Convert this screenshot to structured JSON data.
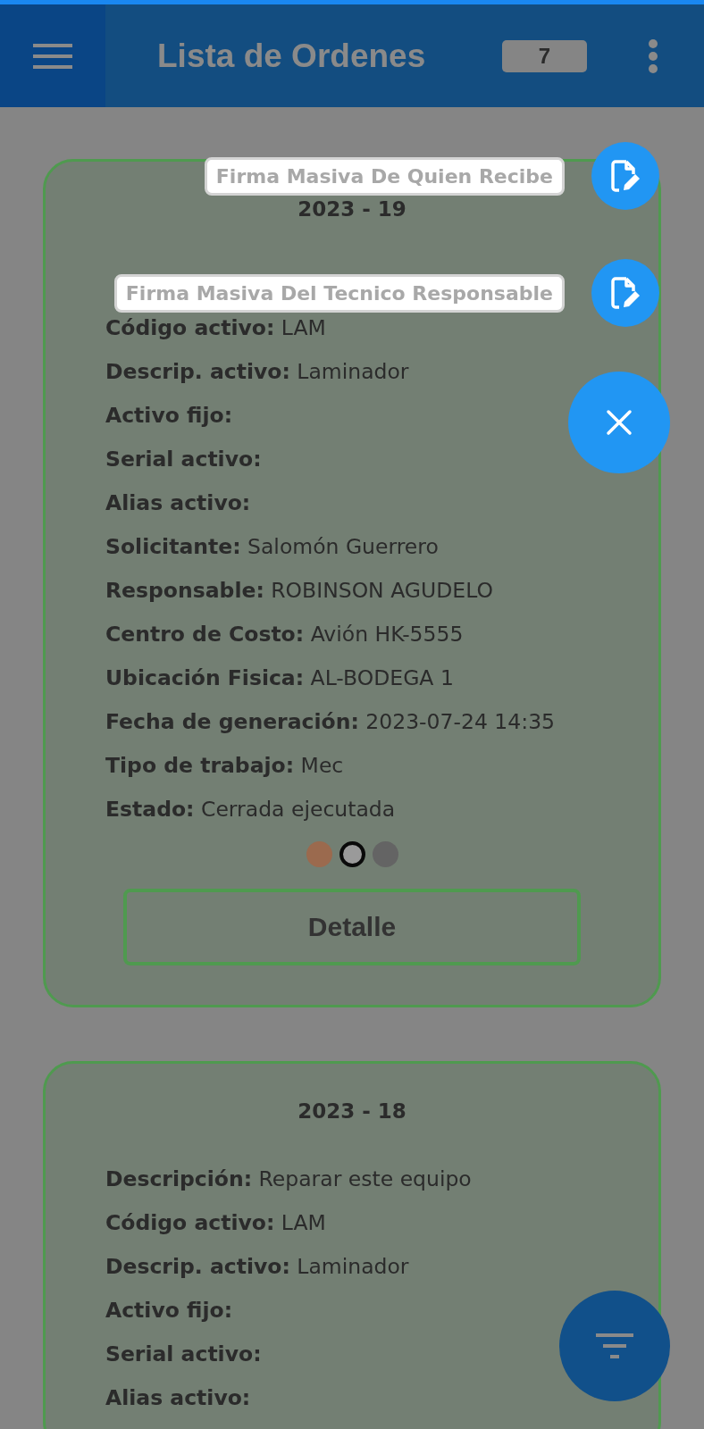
{
  "app_bar": {
    "title": "Lista de Ordenes",
    "count": "7"
  },
  "orders": [
    {
      "title": "2023 - 19",
      "fields": [
        {
          "label": "Código activo:",
          "value": "LAM"
        },
        {
          "label": "Descrip. activo:",
          "value": "Laminador"
        },
        {
          "label": "Activo fijo:"
        },
        {
          "label": "Serial activo:"
        },
        {
          "label": "Alias activo:"
        },
        {
          "label": "Solicitante:",
          "value": "Salomón Guerrero"
        },
        {
          "label": "Responsable:",
          "value": "ROBINSON AGUDELO"
        },
        {
          "label": "Centro de Costo:",
          "value": "Avión HK-5555"
        },
        {
          "label": "Ubicación Fisica:",
          "value": "AL-BODEGA 1"
        },
        {
          "label": "Fecha de generación:",
          "value": "2023-07-24 14:35"
        },
        {
          "label": "Tipo de trabajo:",
          "value": "Mec"
        },
        {
          "label": "Estado:",
          "value": "Cerrada ejecutada"
        }
      ],
      "dots": [
        {
          "color": "#9b6a4e",
          "selected": false
        },
        {
          "color": "#9a9a9a",
          "selected": true
        },
        {
          "color": "#646464",
          "selected": false
        }
      ],
      "button": "Detalle"
    },
    {
      "title": "2023 - 18",
      "fields": [
        {
          "label": "Descripción:",
          "value": "Reparar este equipo"
        },
        {
          "label": "Código activo:",
          "value": "LAM"
        },
        {
          "label": "Descrip. activo:",
          "value": "Laminador"
        },
        {
          "label": "Activo fijo:"
        },
        {
          "label": "Serial activo:"
        },
        {
          "label": "Alias activo:"
        }
      ]
    }
  ],
  "speed_dial": {
    "actions": [
      {
        "label": "Firma Masiva De Quien Recibe"
      },
      {
        "label": "Firma Masiva Del Tecnico Responsable"
      }
    ]
  }
}
